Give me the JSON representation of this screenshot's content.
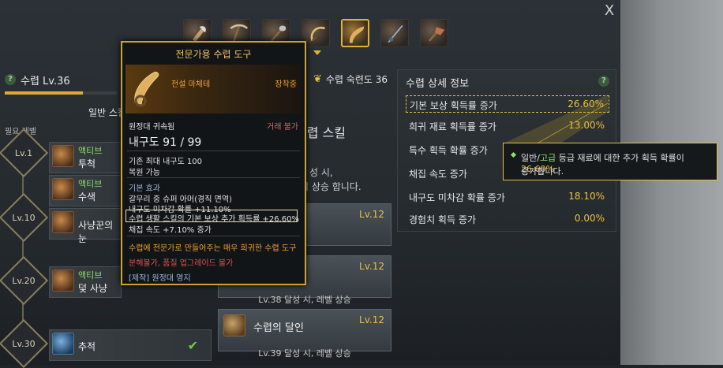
{
  "window": {
    "close_label": "X"
  },
  "tools": {
    "icons": [
      "axe-icon",
      "pickaxe-icon",
      "shovel-icon",
      "sickle-icon",
      "hook-icon",
      "fishing-rod-icon",
      "spade-icon"
    ],
    "selected_index": 4
  },
  "left": {
    "level_title": "수렵 Lv.36",
    "level_progress": 0.7,
    "skill_tab": "일반 스킬",
    "required_level": "필요 레벨",
    "levels": [
      "Lv.1",
      "Lv.10",
      "Lv.20",
      "Lv.30"
    ],
    "skills": [
      {
        "type": "액티브",
        "name": "투척"
      },
      {
        "type": "액티브",
        "name": "수색"
      },
      {
        "type": "",
        "name": "사냥꾼의 눈"
      },
      {
        "type": "액티브",
        "name": "덫 사냥"
      },
      {
        "type": "",
        "name": "추적"
      }
    ]
  },
  "mastery": {
    "label": "수렵 숙련도 36"
  },
  "middle": {
    "title": "수렵 스킬",
    "desc_line1": "성 시,",
    "desc_line2": "이 상승 합니다.",
    "cards": [
      {
        "lv": "Lv.12",
        "foot": ""
      },
      {
        "lv": "Lv.12",
        "foot": "Lv.38 달성 시, 레벨 상승"
      },
      {
        "lv": "Lv.12",
        "name": "수렵의 달인",
        "foot": "Lv.39 달성 시, 레벨 상승"
      }
    ]
  },
  "detail": {
    "title": "수렵 상세 정보",
    "stats": [
      {
        "label": "기본 보상 획득률 증가",
        "value": "26.60%"
      },
      {
        "label": "희귀 재료 획득률 증가",
        "value": "13.00%"
      },
      {
        "label": "특수 획득 확률 증가",
        "value": ""
      },
      {
        "label": "채집 속도 증가",
        "value": ""
      },
      {
        "label": "내구도 미차감 확률 증가",
        "value": "18.10%"
      },
      {
        "label": "경험치 획득 증가",
        "value": "0.00%"
      }
    ]
  },
  "callout": {
    "line1_a": "일반/",
    "line1_b": "고급",
    "line1_c": " 등급 재료에 대한 추가 획득 확률이 ",
    "line1_d": "26.60%",
    "line2": "증가합니다."
  },
  "tooltip": {
    "title": "전문가용 수렵 도구",
    "grade": "전설 마체테",
    "equipped": "장착중",
    "bound": "원정대 귀속됨",
    "trade": "거래 불가",
    "durability": "내구도 91 / 99",
    "max_dur": "기존 최대 내구도 100",
    "restore": "복원 가능",
    "effect_head": "기본 효과",
    "eff1": "갈무리 중 슈퍼 아머(경직 면역)",
    "eff2": "내구도 미차감 확률 +11.10%",
    "eff3": "수렵 생활 스킬의 기본 보상 추가 획득률 +26.60%",
    "eff4": "채집 속도 +7.10% 증가",
    "desc": "수렵에 전문가로 만들어주는 매우 희귀한 수렵 도구",
    "restrict": "분해불가, 품질 업그레이드 불가",
    "craft": "[제작] 원정대 영지"
  },
  "colors": {
    "accent": "#e8c040",
    "green": "#8ee06a",
    "tooltip_border": "#d0a030"
  }
}
